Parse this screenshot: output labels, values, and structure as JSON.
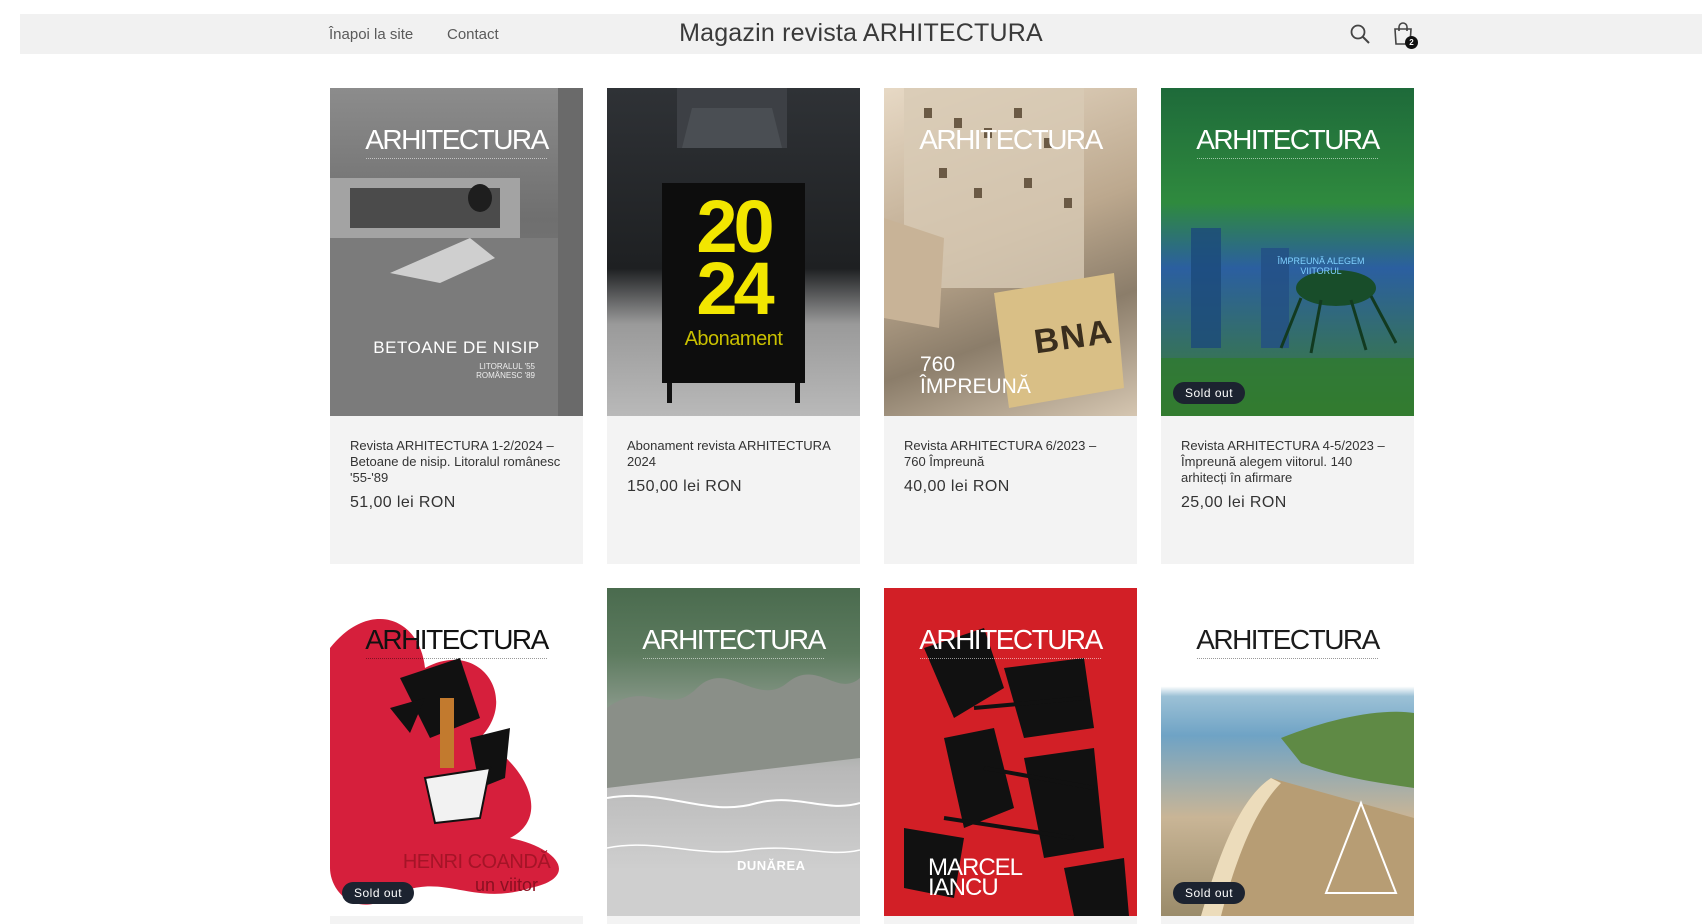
{
  "header": {
    "back_link": "Înapoi la site",
    "contact_link": "Contact",
    "store_title": "Magazin revista ARHITECTURA",
    "search_icon": "search-icon",
    "cart_icon": "shopping-bag-icon",
    "cart_count": "2"
  },
  "products": [
    {
      "title": "Revista ARHITECTURA 1-2/2024 – Betoane de nisip. Litoralul românesc '55-'89",
      "price": "51,00 lei RON",
      "cover_masthead": "ARHITECTURA",
      "cover_text": "BETOANE DE NISIP",
      "cover_subtext": "LITORALUL '55 ROMÂNESC '89",
      "sold_out": false
    },
    {
      "title": "Abonament revista ARHITECTURA 2024",
      "price": "150,00 lei RON",
      "cover_year_top": "20",
      "cover_year_bottom": "24",
      "cover_text": "Abonament",
      "sold_out": false
    },
    {
      "title": "Revista ARHITECTURA 6/2023 – 760 Împreună",
      "price": "40,00 lei RON",
      "cover_masthead": "ARHITECTURA",
      "cover_text_line1": "760",
      "cover_text_line2": "ÎMPREUNĂ",
      "cover_box_text": "BNA",
      "sold_out": false
    },
    {
      "title": "Revista ARHITECTURA 4-5/2023 – Împreună alegem viitorul. 140 arhitecți în afirmare",
      "price": "25,00 lei RON",
      "cover_masthead": "ARHITECTURA",
      "cover_text": "ÎMPREUNĂ ALEGEM VIITORUL",
      "sold_out": true
    },
    {
      "cover_masthead": "ARHITECTURA",
      "cover_text": "HENRI COANDĂ",
      "cover_subtext": "un viitor",
      "sold_out": true
    },
    {
      "cover_masthead": "ARHITECTURA",
      "cover_text": "DUNĂREA",
      "sold_out": false
    },
    {
      "cover_masthead": "ARHITECTURA",
      "cover_text_line1": "MARCEL",
      "cover_text_line2": "IANCU",
      "sold_out": false
    },
    {
      "cover_masthead": "ARHITECTURA",
      "sold_out": true
    }
  ],
  "sold_out_label": "Sold out",
  "colors": {
    "header_bg": "#f1f1f1",
    "card_bg": "#f3f3f3",
    "badge_bg": "#1c2330",
    "accent_yellow": "#f2e600",
    "accent_red": "#d21f26"
  }
}
